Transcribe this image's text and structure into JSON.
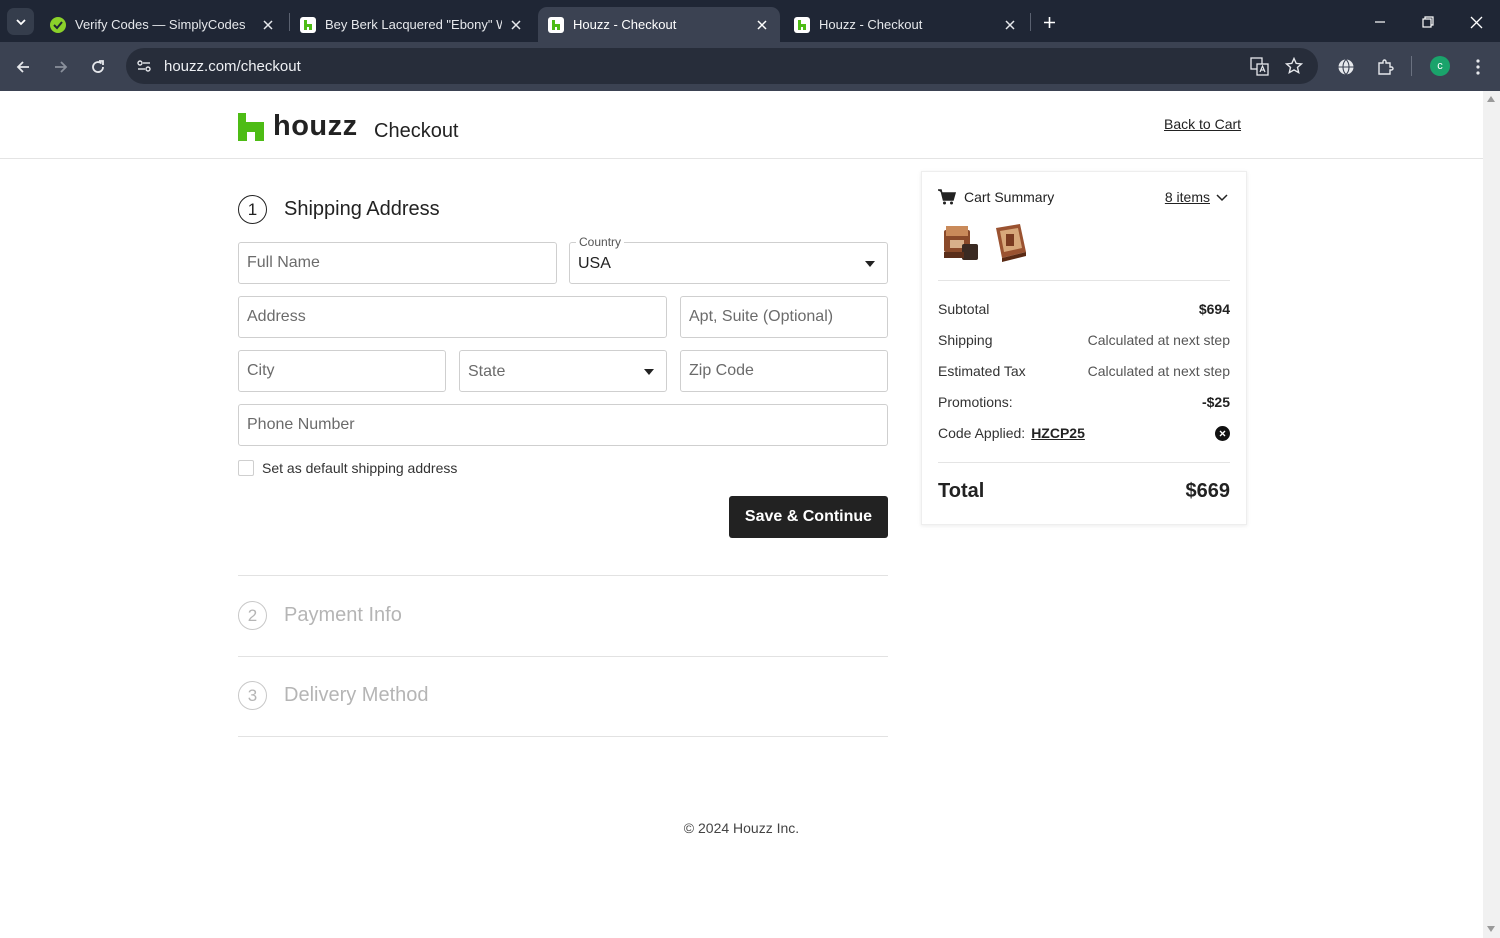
{
  "browser": {
    "tabs": [
      {
        "title": "Verify Codes — SimplyCodes",
        "active": false
      },
      {
        "title": "Bey Berk Lacquered \"Ebony\" Wo",
        "active": false
      },
      {
        "title": "Houzz - Checkout",
        "active": true
      },
      {
        "title": "Houzz - Checkout",
        "active": false
      }
    ],
    "url": "houzz.com/checkout",
    "profile_initial": "c"
  },
  "header": {
    "logo_text": "houzz",
    "page_title": "Checkout",
    "back_link": "Back to Cart"
  },
  "shipping": {
    "step_number": "1",
    "title": "Shipping Address",
    "full_name_placeholder": "Full Name",
    "country_label": "Country",
    "country_value": "USA",
    "address_placeholder": "Address",
    "apt_placeholder": "Apt, Suite (Optional)",
    "city_placeholder": "City",
    "state_placeholder": "State",
    "zip_placeholder": "Zip Code",
    "phone_placeholder": "Phone Number",
    "default_checkbox_label": "Set as default shipping address",
    "save_button": "Save & Continue"
  },
  "payment": {
    "step_number": "2",
    "title": "Payment Info"
  },
  "delivery": {
    "step_number": "3",
    "title": "Delivery Method"
  },
  "cart": {
    "title": "Cart Summary",
    "items_link": "8 items",
    "subtotal_label": "Subtotal",
    "subtotal_value": "$694",
    "shipping_label": "Shipping",
    "shipping_value": "Calculated at next step",
    "tax_label": "Estimated Tax",
    "tax_value": "Calculated at next step",
    "promotions_label": "Promotions:",
    "promotions_value": "-$25",
    "code_label": "Code Applied:",
    "code_value": "HZCP25",
    "total_label": "Total",
    "total_value": "$669"
  },
  "footer": {
    "copyright": "© 2024 Houzz Inc."
  },
  "colors": {
    "brand_green": "#4dbc15",
    "button_dark": "#222222",
    "chrome_dark": "#1f2635",
    "chrome_toolbar": "#3b4252"
  }
}
